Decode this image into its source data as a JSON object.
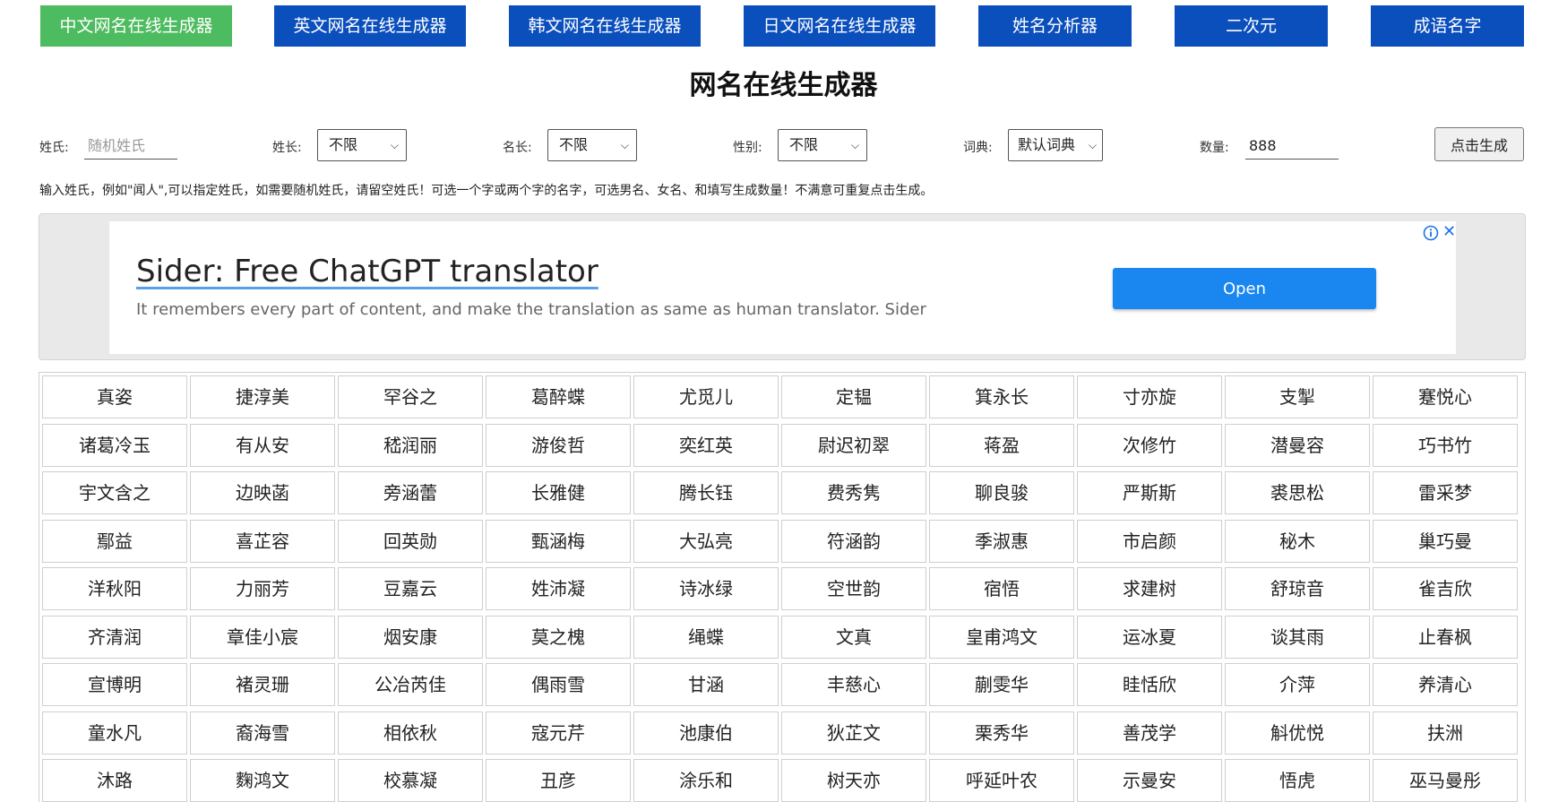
{
  "nav": {
    "items": [
      {
        "label": "中文网名在线生成器",
        "active": true
      },
      {
        "label": "英文网名在线生成器",
        "active": false
      },
      {
        "label": "韩文网名在线生成器",
        "active": false
      },
      {
        "label": "日文网名在线生成器",
        "active": false
      },
      {
        "label": "姓名分析器",
        "active": false
      },
      {
        "label": "二次元",
        "active": false
      },
      {
        "label": "成语名字",
        "active": false
      }
    ]
  },
  "page_title": "网名在线生成器",
  "form": {
    "surname_label": "姓氏:",
    "surname_placeholder": "随机姓氏",
    "surname_length_label": "姓长:",
    "surname_length_value": "不限",
    "name_length_label": "名长:",
    "name_length_value": "不限",
    "gender_label": "性别:",
    "gender_value": "不限",
    "dictionary_label": "词典:",
    "dictionary_value": "默认词典",
    "quantity_label": "数量:",
    "quantity_value": "888",
    "generate_label": "点击生成"
  },
  "hint": "输入姓氏，例如\"闻人\",可以指定姓氏，如需要随机姓氏，请留空姓氏！可选一个字或两个字的名字，可选男名、女名、和填写生成数量！不满意可重复点击生成。",
  "ad": {
    "title": "Sider: Free ChatGPT translator",
    "description": "It remembers every part of content, and make the translation as same as human translator. Sider",
    "open_label": "Open",
    "close_glyph": "✕",
    "accent_color": "#1a86f0"
  },
  "names": [
    [
      "真姿",
      "捷淳美",
      "罕谷之",
      "葛醉蝶",
      "尤觅儿",
      "定韫",
      "箕永长",
      "寸亦旋",
      "支掣",
      "蹇悦心"
    ],
    [
      "诸葛冷玉",
      "有从安",
      "嵇润丽",
      "游俊哲",
      "奕红英",
      "尉迟初翠",
      "蒋盈",
      "次修竹",
      "潜曼容",
      "巧书竹"
    ],
    [
      "宇文含之",
      "边映菡",
      "旁涵蕾",
      "长雅健",
      "腾长钰",
      "费秀隽",
      "聊良骏",
      "严斯斯",
      "裘思松",
      "雷采梦"
    ],
    [
      "鄢益",
      "喜芷容",
      "回英勋",
      "甄涵梅",
      "大弘亮",
      "符涵韵",
      "季淑惠",
      "市启颜",
      "秘木",
      "巢巧曼"
    ],
    [
      "洋秋阳",
      "力丽芳",
      "豆嘉云",
      "姓沛凝",
      "诗冰绿",
      "空世韵",
      "宿悟",
      "求建树",
      "舒琼音",
      "雀吉欣"
    ],
    [
      "齐清润",
      "章佳小宸",
      "烟安康",
      "莫之槐",
      "绳蝶",
      "文真",
      "皇甫鸿文",
      "运冰夏",
      "谈其雨",
      "止春枫"
    ],
    [
      "宣博明",
      "褚灵珊",
      "公冶芮佳",
      "偶雨雪",
      "甘涵",
      "丰慈心",
      "蒯雯华",
      "眭恬欣",
      "介萍",
      "养清心"
    ],
    [
      "童水凡",
      "裔海雪",
      "相依秋",
      "寇元芹",
      "池康伯",
      "狄芷文",
      "栗秀华",
      "善茂学",
      "斛优悦",
      "扶洲"
    ],
    [
      "沐路",
      "麴鸿文",
      "校慕凝",
      "丑彦",
      "涂乐和",
      "树天亦",
      "呼延叶农",
      "示曼安",
      "悟虎",
      "巫马曼彤"
    ]
  ]
}
